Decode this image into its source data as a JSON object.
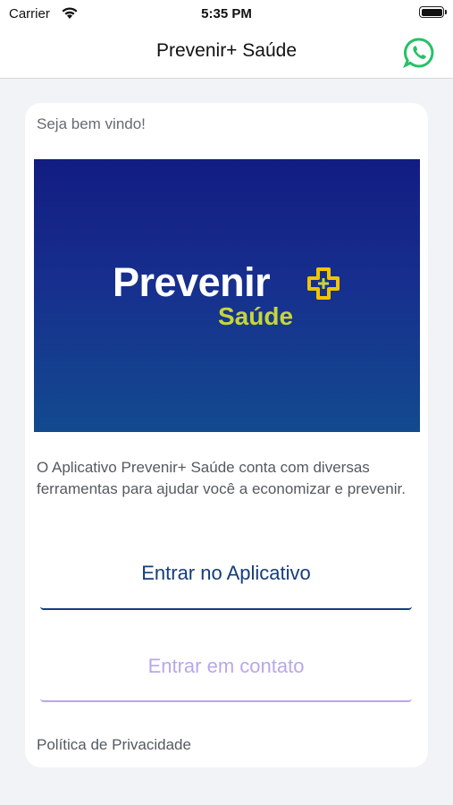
{
  "status_bar": {
    "carrier": "Carrier",
    "time": "5:35 PM"
  },
  "nav": {
    "title": "Prevenir+ Saúde",
    "whatsapp_icon": "whatsapp-icon",
    "whatsapp_color": "#25c265"
  },
  "card": {
    "greeting": "Seja bem vindo!",
    "banner": {
      "brand_name": "Prevenir",
      "brand_sub": "Saúde",
      "gradient_top": "#121c82",
      "gradient_bottom": "#124a8f",
      "accent_yellow": "#f2c400",
      "accent_green": "#c6d637"
    },
    "description": "O Aplicativo Prevenir+ Saúde conta com diversas ferramentas para ajudar você a economizar e prevenir.",
    "enter_button": "Entrar no Aplicativo",
    "contact_button": "Entrar em contato",
    "privacy_link": "Política de Privacidade"
  },
  "colors": {
    "primary": "#153d7a",
    "secondary": "#b7a8ec",
    "background": "#f2f3f6"
  }
}
